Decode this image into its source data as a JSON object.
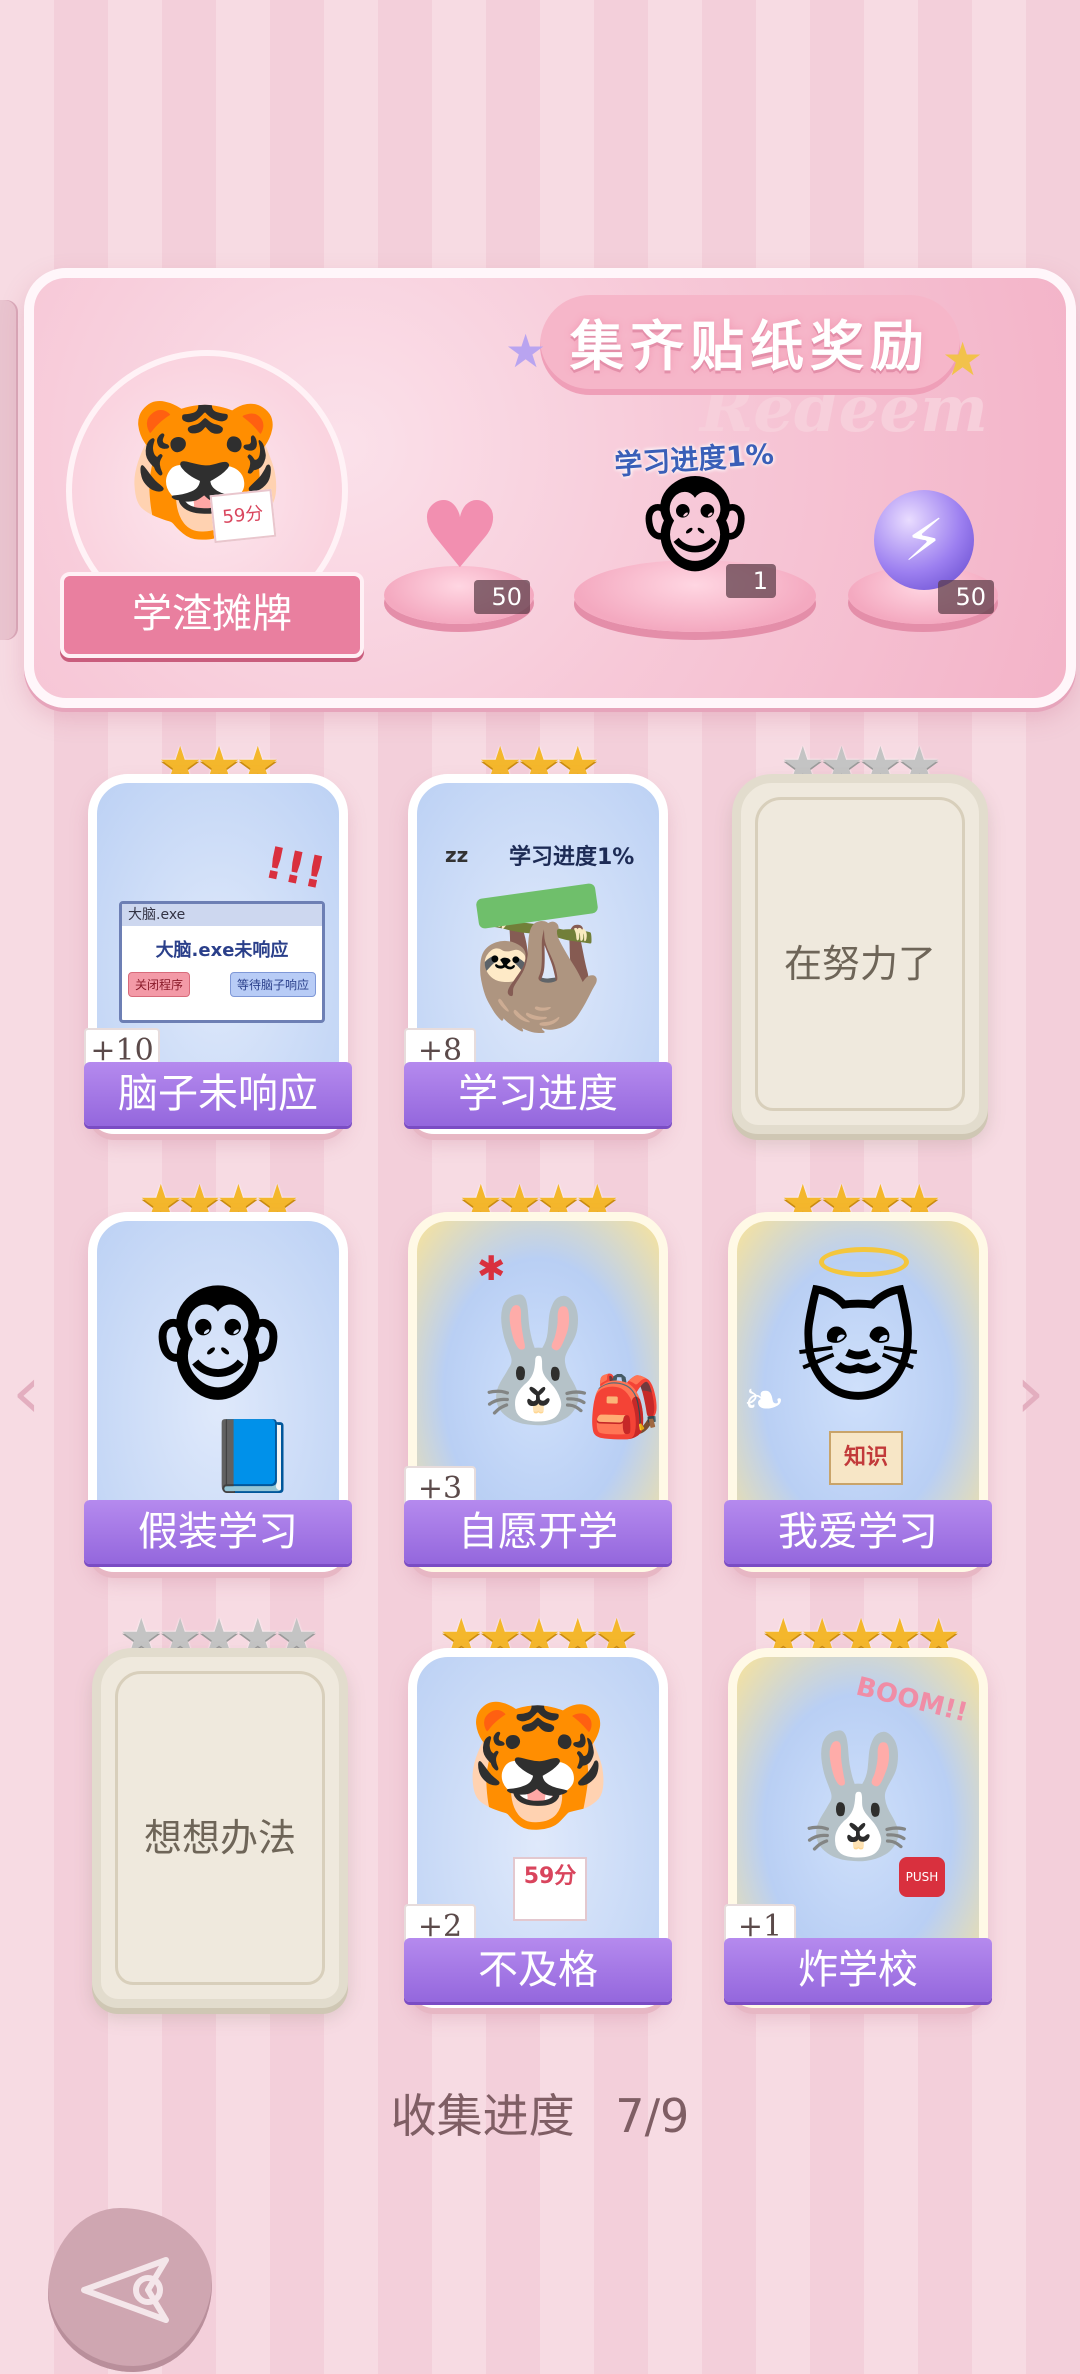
{
  "banner": {
    "title": "集齐贴纸奖励",
    "watermark": "Redeem",
    "player_title": "学渣摊牌",
    "avatar_note": "59分",
    "rewards": [
      {
        "icon": "heart-gem-icon",
        "count": "50"
      },
      {
        "icon": "monkey-icon",
        "count": "1",
        "label": "学习进度1%"
      },
      {
        "icon": "energy-orb-icon",
        "count": "50"
      }
    ]
  },
  "cards": [
    {
      "name": "脑子未响应",
      "stars_filled": 3,
      "stars_total": 3,
      "tag": "+10",
      "locked": false,
      "art": "brain-not-responding"
    },
    {
      "name": "学习进度",
      "stars_filled": 3,
      "stars_total": 3,
      "tag": "+8",
      "locked": false,
      "art": "sleeping-sloth",
      "art_label": "学习进度1%"
    },
    {
      "name": "在努力了",
      "stars_filled": 0,
      "stars_total": 4,
      "locked": true
    },
    {
      "name": "假装学习",
      "stars_filled": 4,
      "stars_total": 4,
      "locked": false,
      "art": "monkey-reading"
    },
    {
      "name": "自愿开学",
      "stars_filled": 4,
      "stars_total": 4,
      "tag": "+3",
      "locked": false,
      "art": "bunny-backpack"
    },
    {
      "name": "我爱学习",
      "stars_filled": 4,
      "stars_total": 4,
      "locked": false,
      "art": "angel-cat",
      "art_label": "知识"
    },
    {
      "name": "想想办法",
      "stars_filled": 0,
      "stars_total": 5,
      "locked": true
    },
    {
      "name": "不及格",
      "stars_filled": 5,
      "stars_total": 5,
      "tag": "+2",
      "locked": false,
      "art": "tiger-59",
      "art_label": "59分"
    },
    {
      "name": "炸学校",
      "stars_filled": 5,
      "stars_total": 5,
      "tag": "+1",
      "locked": false,
      "art": "bunny-boom",
      "art_label": "BOOM!!"
    }
  ],
  "popup": {
    "title": "大脑.exe",
    "message": "大脑.exe未响应",
    "btn_close": "关闭程序",
    "btn_wait": "等待脑子响应"
  },
  "progress": {
    "label": "收集进度",
    "value": "7/9"
  },
  "nav": {
    "prev": "‹",
    "next": "›"
  }
}
